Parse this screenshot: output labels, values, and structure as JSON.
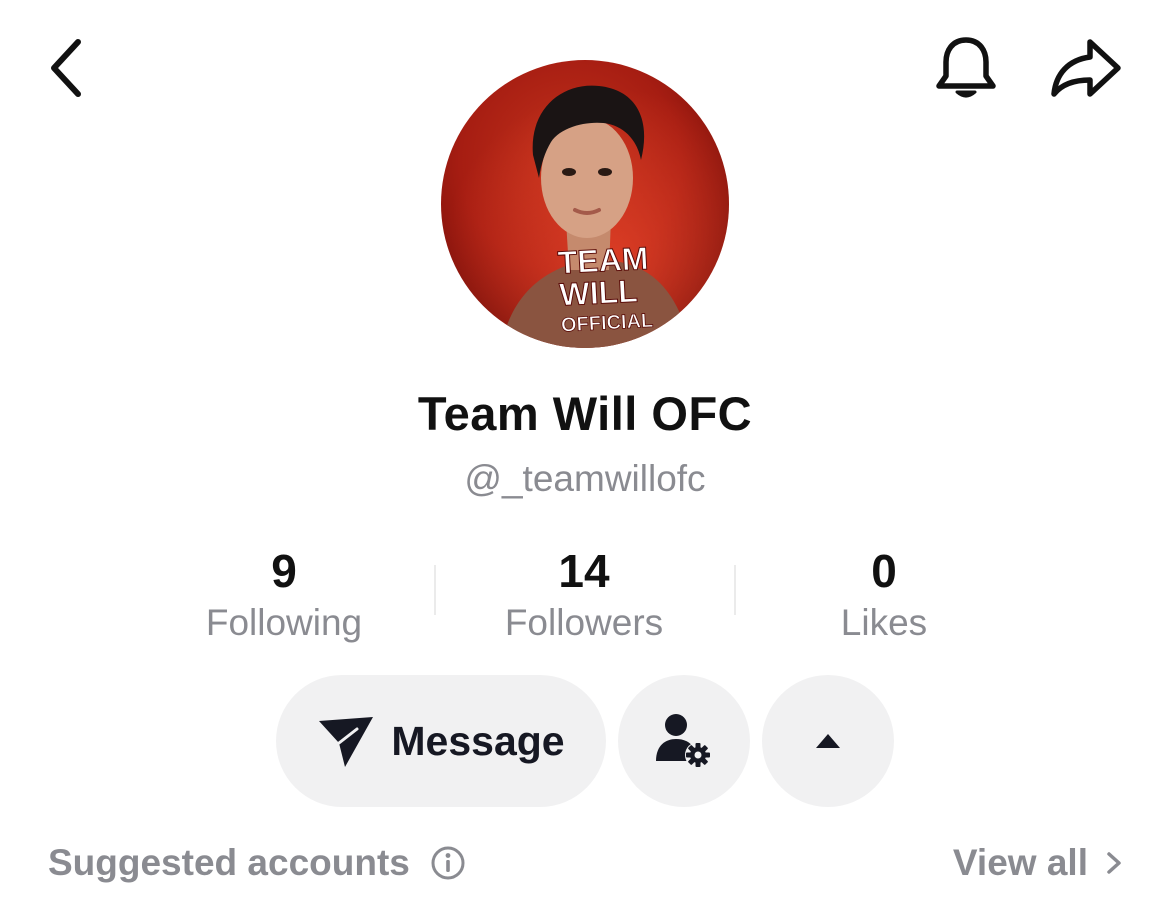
{
  "header": {
    "back_icon": "chevron-left-icon",
    "notification_icon": "bell-icon",
    "share_icon": "share-arrow-icon"
  },
  "profile": {
    "avatar_text_line1": "TEAM",
    "avatar_text_line2": "WILL",
    "avatar_text_line3": "OFFICIAL",
    "display_name": "Team Will OFC",
    "handle": "@_teamwillofc"
  },
  "stats": [
    {
      "value": "9",
      "label": "Following"
    },
    {
      "value": "14",
      "label": "Followers"
    },
    {
      "value": "0",
      "label": "Likes"
    }
  ],
  "actions": {
    "message_label": "Message",
    "message_icon": "send-paper-plane-icon",
    "friend_settings_icon": "user-gear-icon",
    "more_icon": "caret-up-icon"
  },
  "suggested": {
    "title": "Suggested accounts",
    "info_icon": "info-icon",
    "view_all": "View all"
  },
  "colors": {
    "text_primary": "#161823",
    "text_secondary": "#8a8b91",
    "button_bg": "#f1f1f2",
    "avatar_red": "#a61d12"
  }
}
